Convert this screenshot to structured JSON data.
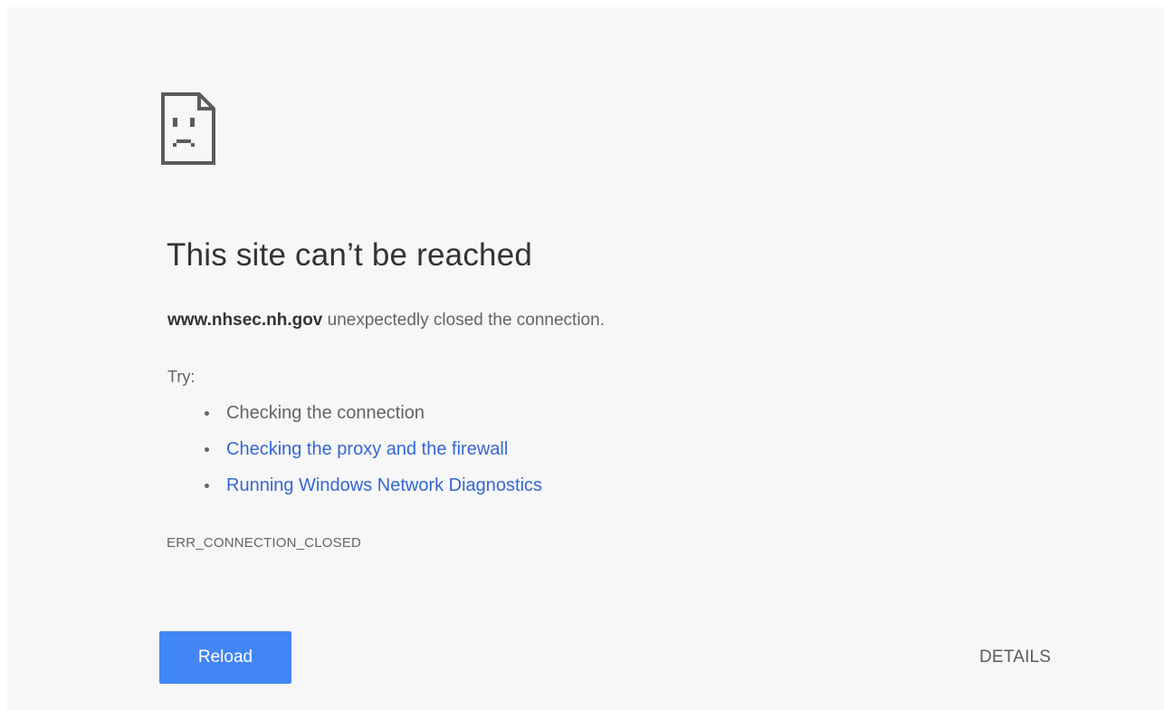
{
  "error_page": {
    "icon": "sad-page-icon",
    "title": "This site can’t be reached",
    "summary": {
      "host": "www.nhsec.nh.gov",
      "message": " unexpectedly closed the connection."
    },
    "try_label": "Try:",
    "suggestions": [
      {
        "text": "Checking the connection",
        "is_link": false
      },
      {
        "text": "Checking the proxy and the firewall",
        "is_link": true
      },
      {
        "text": "Running Windows Network Diagnostics",
        "is_link": true
      }
    ],
    "error_code": "ERR_CONNECTION_CLOSED"
  },
  "buttons": {
    "reload_label": "Reload",
    "details_label": "DETAILS"
  },
  "colors": {
    "background": "#f7f7f7",
    "title_text": "#333333",
    "body_text": "#646464",
    "link": "#3367d6",
    "reload_button": "#4285f4",
    "reload_text": "#ffffff"
  }
}
